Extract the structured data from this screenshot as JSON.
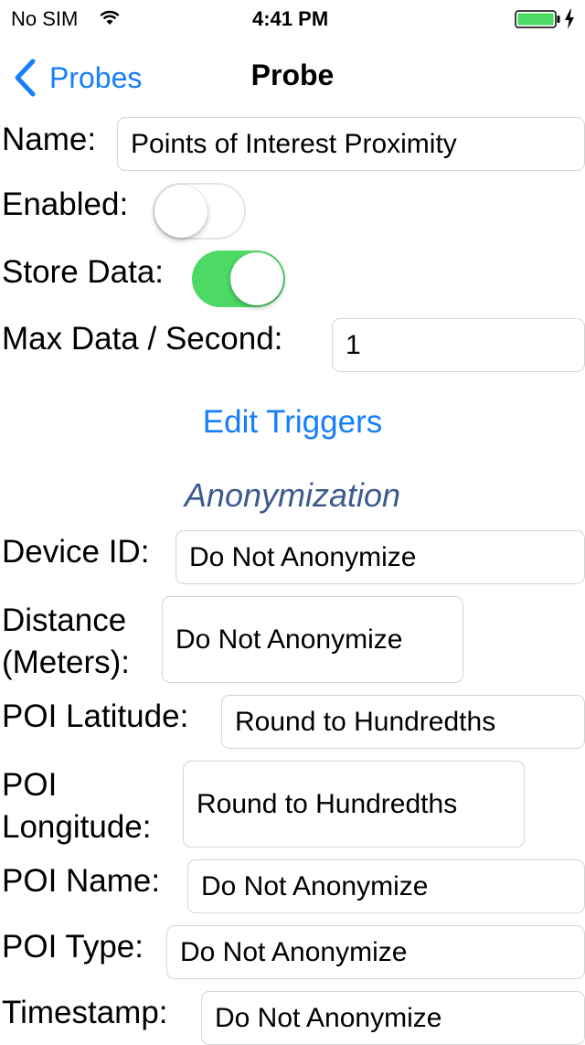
{
  "status_bar": {
    "carrier": "No SIM",
    "time": "4:41 PM"
  },
  "nav": {
    "back_label": "Probes",
    "title": "Probe"
  },
  "form": {
    "name_label": "Name:",
    "name_value": "Points of Interest Proximity",
    "enabled_label": "Enabled:",
    "enabled_on": false,
    "store_label": "Store Data:",
    "store_on": true,
    "max_label": "Max Data / Second:",
    "max_value": "1",
    "edit_triggers": "Edit Triggers"
  },
  "anonymization": {
    "heading": "Anonymization",
    "device_id_label": "Device ID:",
    "device_id_value": "Do Not Anonymize",
    "distance_label_1": "Distance",
    "distance_label_2": "(Meters):",
    "distance_value": "Do Not Anonymize",
    "poi_lat_label": "POI Latitude:",
    "poi_lat_value": "Round to Hundredths",
    "poi_lon_label_1": "POI",
    "poi_lon_label_2": "Longitude:",
    "poi_lon_value": "Round to Hundredths",
    "poi_name_label": "POI Name:",
    "poi_name_value": "Do Not Anonymize",
    "poi_type_label": "POI Type:",
    "poi_type_value": "Do Not Anonymize",
    "timestamp_label": "Timestamp:",
    "timestamp_value": "Do Not Anonymize"
  },
  "colors": {
    "accent": "#157efb",
    "heading": "#3c5a8e",
    "switch_on": "#4cd964",
    "battery": "#4cd964"
  },
  "icons": {
    "wifi": "wifi-icon",
    "battery": "battery-icon",
    "charging": "charging-bolt-icon",
    "back": "chevron-left-icon"
  }
}
